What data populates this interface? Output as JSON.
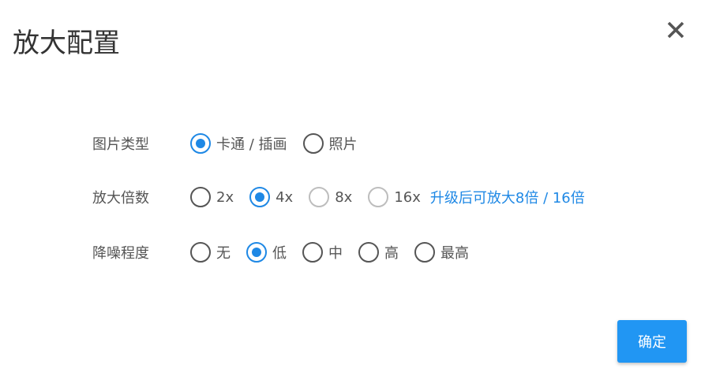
{
  "dialog": {
    "title": "放大配置",
    "confirm_label": "确定"
  },
  "image_type": {
    "label": "图片类型",
    "options": [
      {
        "label": "卡通 / 插画",
        "selected": true
      },
      {
        "label": "照片",
        "selected": false
      }
    ]
  },
  "scale": {
    "label": "放大倍数",
    "options": [
      {
        "label": "2x",
        "selected": false,
        "disabled": false
      },
      {
        "label": "4x",
        "selected": true,
        "disabled": false
      },
      {
        "label": "8x",
        "selected": false,
        "disabled": true
      },
      {
        "label": "16x",
        "selected": false,
        "disabled": true
      }
    ],
    "upgrade_link": "升级后可放大8倍 / 16倍"
  },
  "denoise": {
    "label": "降噪程度",
    "options": [
      {
        "label": "无",
        "selected": false
      },
      {
        "label": "低",
        "selected": true
      },
      {
        "label": "中",
        "selected": false
      },
      {
        "label": "高",
        "selected": false
      },
      {
        "label": "最高",
        "selected": false
      }
    ]
  },
  "colors": {
    "accent": "#1e88e5",
    "button": "#2196f3",
    "disabled_radio": "#bdbdbd",
    "radio_border": "#555555"
  },
  "icons": {
    "close": "close-icon"
  }
}
